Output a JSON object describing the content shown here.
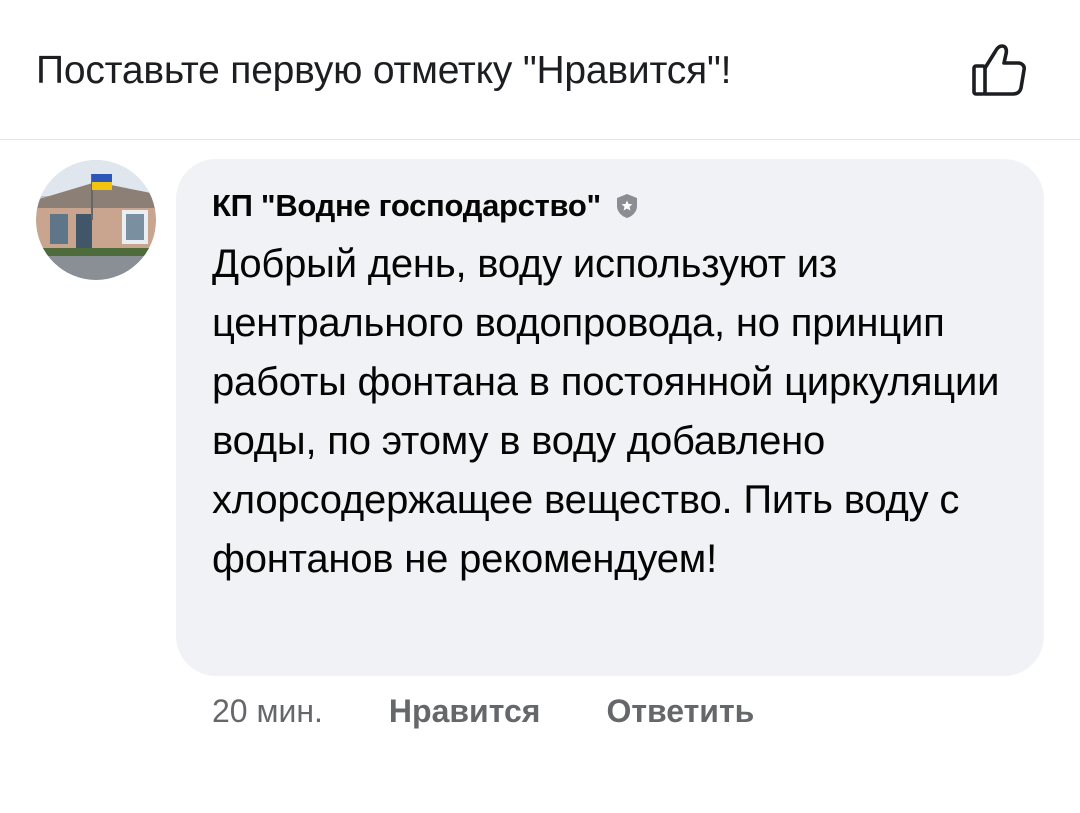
{
  "header": {
    "prompt_text": "Поставьте первую отметку \"Нравится\"!",
    "like_icon": "thumbs-up-outline-icon"
  },
  "comment": {
    "author": "КП \"Водне господарство\"",
    "badge_icon": "page-badge-icon",
    "avatar_icon": "building-photo-avatar",
    "text": "Добрый день, воду используют из центрального водопровода, но принцип работы фонтана в постоянной циркуляции воды, по этому в воду добавлено хлорсодержащее вещество. Пить воду с фонтанов не рекомендуем!",
    "time": "20 мин.",
    "like_label": "Нравится",
    "reply_label": "Ответить"
  },
  "colors": {
    "bubble_bg": "#f0f2f5",
    "meta_text": "#65676b",
    "primary_text": "#050505"
  }
}
